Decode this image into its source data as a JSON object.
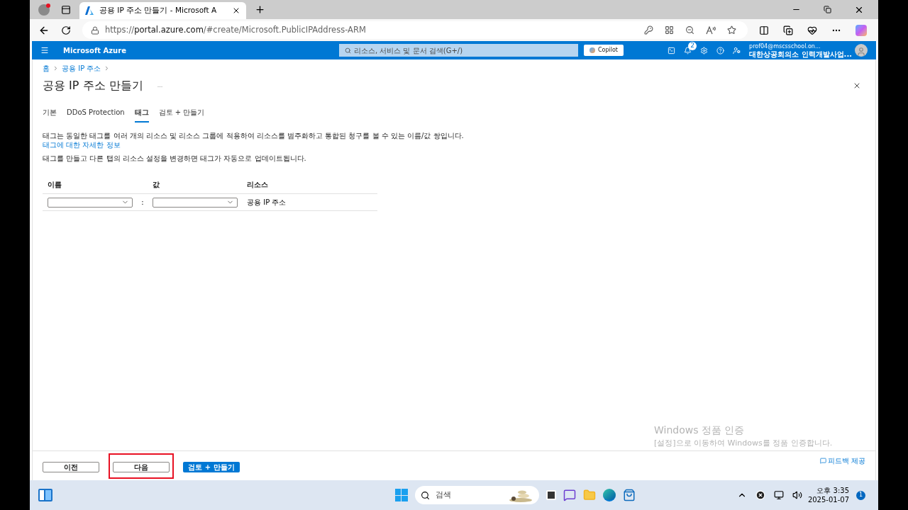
{
  "browser": {
    "tab_title": "공용 IP 주소 만들기 - Microsoft A",
    "url_prefix": "https://",
    "url_host": "portal.azure.com",
    "url_path": "/#create/Microsoft.PublicIPAddress-ARM"
  },
  "portal": {
    "brand": "Microsoft Azure",
    "search_placeholder": "리소스, 서비스 및 문서 검색(G+/)",
    "copilot": "Copilot",
    "notification_count": "2",
    "account_email": "prof04@mscsschool.on...",
    "account_org": "대한상공회의소 인력개발사업..."
  },
  "breadcrumb": [
    "홈",
    "공용 IP 주소"
  ],
  "page_title": "공용 IP 주소 만들기",
  "more": "...",
  "tabs": [
    {
      "label": "기본",
      "selected": false
    },
    {
      "label": "DDoS Protection",
      "selected": false
    },
    {
      "label": "태그",
      "selected": true
    },
    {
      "label": "검토 + 만들기",
      "selected": false
    }
  ],
  "description": "태그는 동일한 태그를 여러 개의 리소스 및 리소스 그룹에 적용하여 리소스를 범주화하고 통합된 청구를 볼 수 있는 이름/값 쌍입니다.",
  "description_link": "태그에 대한 자세한 정보",
  "note": "태그를 만들고 다른 탭의 리소스 설정을 변경하면 태그가 자동으로 업데이트됩니다.",
  "table": {
    "columns": [
      "이름",
      "값",
      "리소스"
    ],
    "rows": [
      {
        "separator": ":",
        "resource": "공용 IP 주소"
      }
    ]
  },
  "footer_buttons": [
    {
      "label": "이전",
      "kind": "secondary",
      "highlighted": false
    },
    {
      "label": "다음",
      "kind": "secondary",
      "highlighted": true
    },
    {
      "label": "검토 + 만들기",
      "kind": "primary",
      "highlighted": false
    }
  ],
  "feedback": "피드백 제공",
  "activation": {
    "title": "Windows 정품 인증",
    "text": "[설정]으로 이동하여 Windows를 정품 인증합니다."
  },
  "taskbar": {
    "search": "검색",
    "time": "오후 3:35",
    "date": "2025-01-07",
    "notification_count": "1"
  }
}
